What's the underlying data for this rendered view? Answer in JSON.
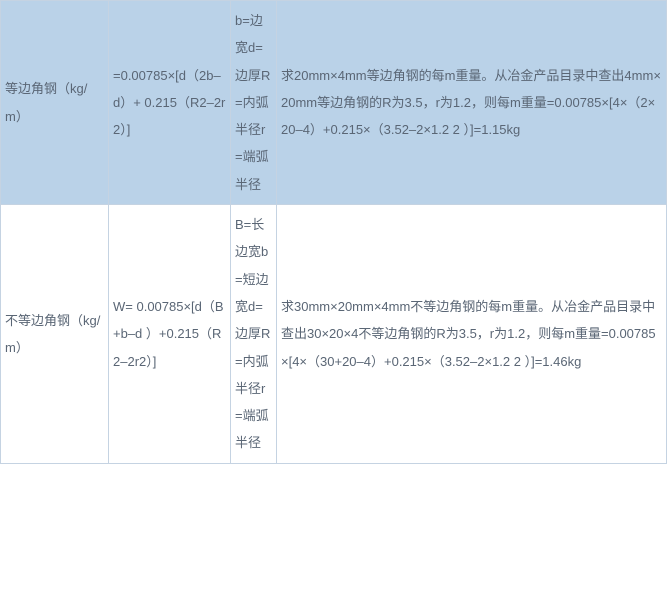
{
  "rows": [
    {
      "highlight": true,
      "name": "等边角钢（kg/m）",
      "formula": "=0.00785×[d（2b–d）+ 0.215（R2–2r2）]",
      "symbols": "b=边宽d=边厚R=内弧半径r=端弧半径",
      "example": "求20mm×4mm等边角钢的每m重量。从冶金产品目录中查出4mm×20mm等边角钢的R为3.5，r为1.2，则每m重量=0.00785×[4×（2×20–4）+0.215×（3.52–2×1.2 2 ）]=1.15kg"
    },
    {
      "highlight": false,
      "name": "不等边角钢（kg/m）",
      "formula": "W= 0.00785×[d（B+b–d ）+0.215（R2–2r2）]",
      "symbols": "B=长边宽b=短边宽d=边厚R=内弧半径r=端弧半径",
      "example": "求30mm×20mm×4mm不等边角钢的每m重量。从冶金产品目录中查出30×20×4不等边角钢的R为3.5，r为1.2，则每m重量=0.00785×[4×（30+20–4）+0.215×（3.52–2×1.2 2 ）]=1.46kg"
    }
  ]
}
